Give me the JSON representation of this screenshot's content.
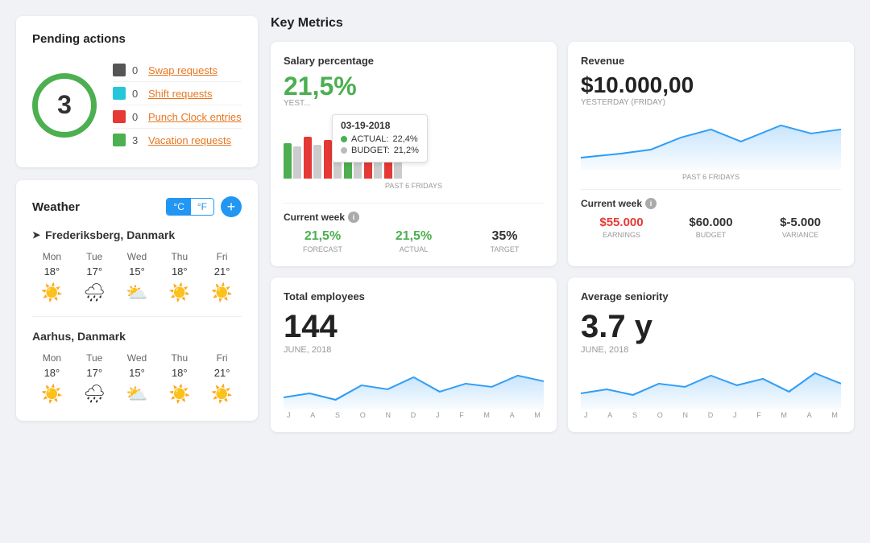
{
  "pending": {
    "title": "Pending actions",
    "total": "3",
    "items": [
      {
        "color": "#555",
        "count": "0",
        "label": "Swap requests",
        "id": "swap"
      },
      {
        "color": "#26c6da",
        "count": "0",
        "label": "Shift requests",
        "id": "shift"
      },
      {
        "color": "#e53935",
        "count": "0",
        "label": "Punch Clock entries",
        "id": "punch"
      },
      {
        "color": "#4caf50",
        "count": "3",
        "label": "Vacation requests",
        "id": "vacation"
      }
    ]
  },
  "weather": {
    "title": "Weather",
    "temp_c": "°C",
    "temp_f": "°F",
    "add_label": "+",
    "locations": [
      {
        "name": "Frederiksberg, Danmark",
        "days": [
          {
            "day": "Mon",
            "temp": "18°",
            "icon": "☀️"
          },
          {
            "day": "Tue",
            "temp": "17°",
            "icon": "🌧"
          },
          {
            "day": "Wed",
            "temp": "15°",
            "icon": "⛅"
          },
          {
            "day": "Thu",
            "temp": "18°",
            "icon": "☀️"
          },
          {
            "day": "Fri",
            "temp": "21°",
            "icon": "☀️"
          }
        ]
      },
      {
        "name": "Aarhus, Danmark",
        "days": [
          {
            "day": "Mon",
            "temp": "18°",
            "icon": "☀️"
          },
          {
            "day": "Tue",
            "temp": "17°",
            "icon": "🌧"
          },
          {
            "day": "Wed",
            "temp": "15°",
            "icon": "⛅"
          },
          {
            "day": "Thu",
            "temp": "18°",
            "icon": "☀️"
          },
          {
            "day": "Fri",
            "temp": "21°",
            "icon": "☀️"
          }
        ]
      }
    ]
  },
  "key_metrics": {
    "title": "Key Metrics",
    "salary": {
      "title": "Salary percentage",
      "value": "21,5%",
      "period_label": "YEST...",
      "tooltip": {
        "date": "03-19-2018",
        "actual_label": "ACTUAL:",
        "actual_value": "22,4%",
        "budget_label": "BUDGET:",
        "budget_value": "21,2%"
      },
      "chart_label": "PAST 6 FRIDAYS",
      "current_week_label": "Current week",
      "forecast_label": "FORECAST",
      "forecast_value": "21,5%",
      "actual_label": "ACTUAL",
      "actual_value": "21,5%",
      "target_label": "TARGET",
      "target_value": "35%"
    },
    "revenue": {
      "title": "Revenue",
      "value": "$10.000,00",
      "period_label": "YESTERDAY (FRIDAY)",
      "chart_label": "PAST 6 FRIDAYS",
      "current_week_label": "Current week",
      "earnings_label": "EARNINGS",
      "earnings_value": "$55.000",
      "budget_label": "BUDGET",
      "budget_value": "$60.000",
      "variance_label": "VARIANCE",
      "variance_value": "$-5.000"
    },
    "employees": {
      "title": "Total employees",
      "value": "144",
      "period": "JUNE, 2018",
      "months": [
        "J",
        "A",
        "S",
        "O",
        "N",
        "D",
        "J",
        "F",
        "M",
        "A",
        "M"
      ]
    },
    "seniority": {
      "title": "Average seniority",
      "value": "3.7 y",
      "period": "JUNE, 2018",
      "months": [
        "J",
        "A",
        "S",
        "O",
        "N",
        "D",
        "J",
        "F",
        "M",
        "A",
        "M"
      ]
    }
  }
}
